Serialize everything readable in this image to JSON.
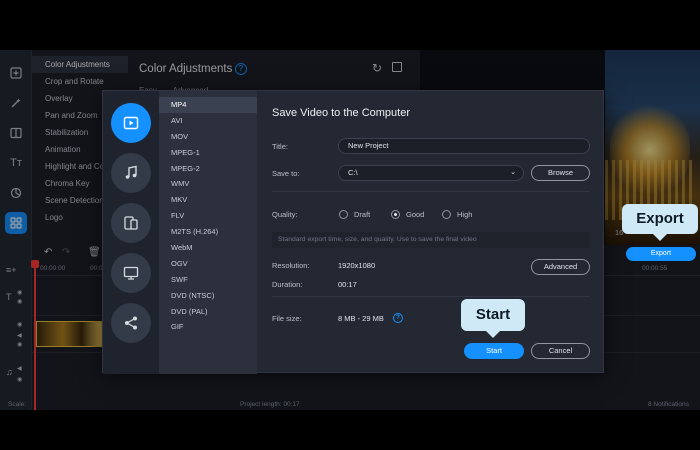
{
  "tools": {
    "title": "Color Adjustments",
    "sub_tabs": [
      "Easy",
      "Advanced"
    ],
    "items": [
      {
        "label": "Color Adjustments",
        "active": true
      },
      {
        "label": "Crop and Rotate"
      },
      {
        "label": "Overlay"
      },
      {
        "label": "Pan and Zoom"
      },
      {
        "label": "Stabilization"
      },
      {
        "label": "Animation"
      },
      {
        "label": "Highlight and Co"
      },
      {
        "label": "Chroma Key"
      },
      {
        "label": "Scene Detection"
      },
      {
        "label": "Logo"
      }
    ]
  },
  "preview": {
    "time_left": "16",
    "time_right": "00:00:55"
  },
  "timeline": {
    "ruler": [
      "00:00:00",
      "00:00:05"
    ],
    "ruler_right": "00:00:55"
  },
  "statusbar": {
    "scale": "Scale:",
    "project_length": "Project length: 00:17",
    "notifications": "8 Notifications"
  },
  "dialog": {
    "title": "Save Video to the Computer",
    "categories": [
      "video-icon",
      "music-icon",
      "devices-icon",
      "tv-icon",
      "share-icon"
    ],
    "formats": [
      {
        "label": "MP4",
        "active": true
      },
      {
        "label": "AVI"
      },
      {
        "label": "MOV"
      },
      {
        "label": "MPEG-1"
      },
      {
        "label": "MPEG-2"
      },
      {
        "label": "WMV"
      },
      {
        "label": "MKV"
      },
      {
        "label": "FLV"
      },
      {
        "label": "M2TS (H.264)"
      },
      {
        "label": "WebM"
      },
      {
        "label": "OGV"
      },
      {
        "label": "SWF"
      },
      {
        "label": "DVD (NTSC)"
      },
      {
        "label": "DVD (PAL)"
      },
      {
        "label": "GIF"
      }
    ],
    "title_label": "Title:",
    "title_value": "New Project",
    "save_to_label": "Save to:",
    "save_to_value": "C:\\",
    "browse_label": "Browse",
    "quality_label": "Quality:",
    "quality_options": [
      "Draft",
      "Good",
      "High"
    ],
    "quality_selected": "Good",
    "hint": "Standard export time, size, and quality. Use to save the final video",
    "resolution_label": "Resolution:",
    "resolution_value": "1920x1080",
    "advanced_label": "Advanced",
    "duration_label": "Duration:",
    "duration_value": "00:17",
    "file_size_label": "File size:",
    "file_size_value": "8 MB - 29 MB",
    "start_label": "Start",
    "cancel_label": "Cancel"
  },
  "callouts": {
    "export": "Export",
    "start": "Start"
  },
  "export_button": "Export",
  "colors": {
    "accent": "#1591ff",
    "callout_bg": "#cfeaf6",
    "dialog_bg": "#232833"
  }
}
